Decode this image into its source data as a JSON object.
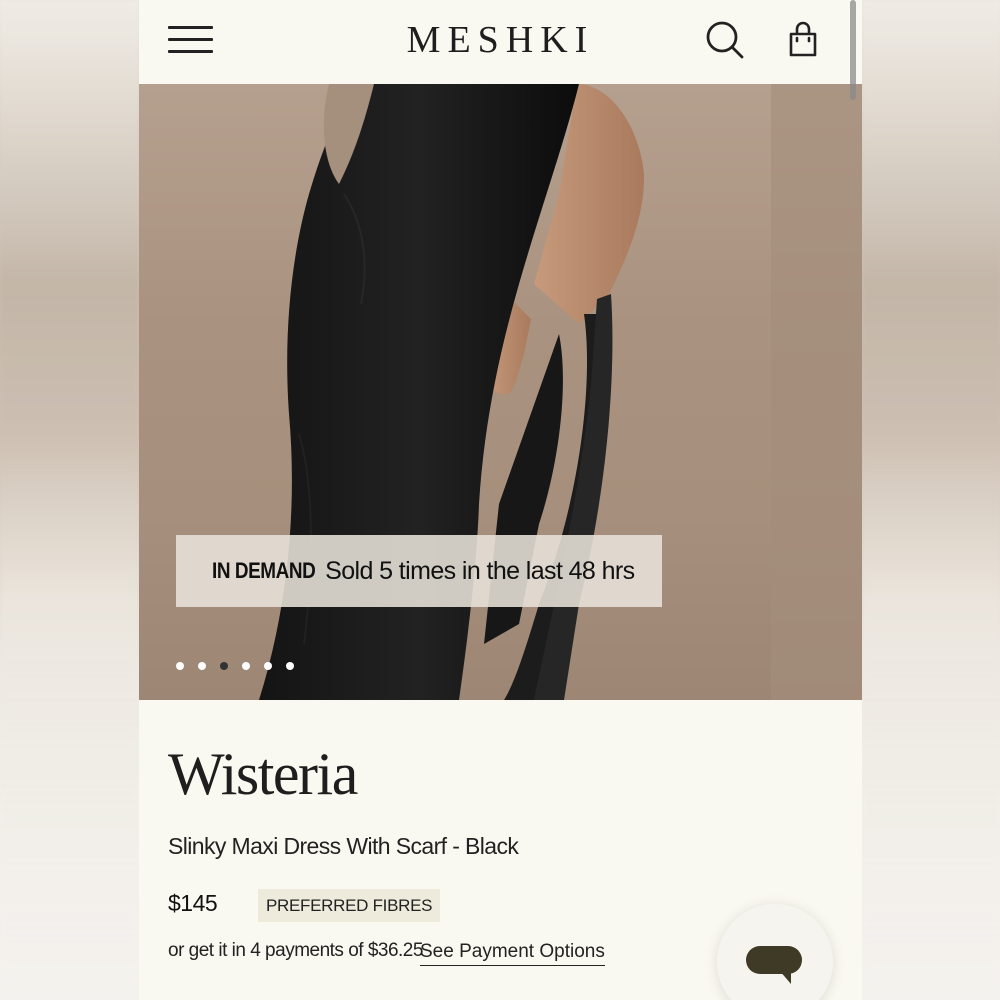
{
  "header": {
    "logo": "MESHKI",
    "menu_icon": "hamburger-menu-icon",
    "search_icon": "search-icon",
    "bag_icon": "shopping-bag-icon"
  },
  "hero": {
    "banner_tag": "IN DEMAND",
    "banner_text": "Sold 5 times in the last 48 hrs",
    "carousel": {
      "total": 6,
      "active_index": 3
    }
  },
  "product": {
    "name": "Wisteria",
    "subtitle": "Slinky Maxi Dress With Scarf - Black",
    "price": "$145",
    "badge": "PREFERRED FIBRES",
    "installments": "or get it in 4 payments of $36.25",
    "payment_link": "See Payment Options"
  },
  "chat": {
    "icon": "chat-bubble-icon"
  },
  "colors": {
    "page_bg": "#faf9f1",
    "text": "#1e1e1e",
    "badge_bg": "#eeeadc",
    "chat_icon": "#3e3a26"
  }
}
